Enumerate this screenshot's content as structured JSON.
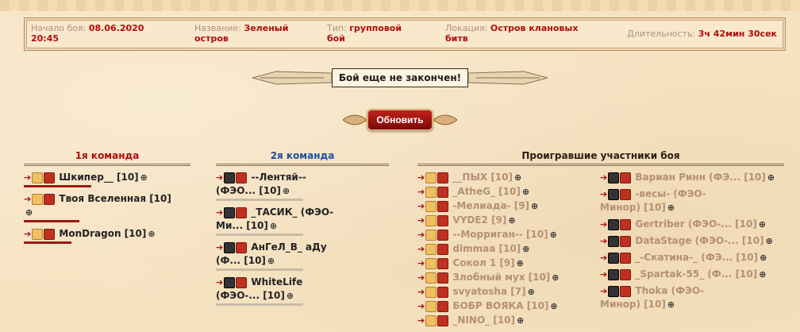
{
  "info": {
    "start_label": "Начало боя:",
    "start_value_line1": "08.06.2020",
    "start_value_line2": "20:45",
    "name_label": "Название:",
    "name_value_line1": "Зеленый",
    "name_value_line2": "остров",
    "type_label": "Тип:",
    "type_value_line1": "групповой",
    "type_value_line2": "бой",
    "location_label": "Локация:",
    "location_value_line1": "Остров клановых",
    "location_value_line2": "битв",
    "duration_label": "Длительность:",
    "duration_value": "3ч 42мин 30сек"
  },
  "status": "Бой еще не закончен!",
  "refresh_label": "Обновить",
  "team1": {
    "title": "1я команда",
    "players": [
      {
        "name": "Шкипер__ [10]"
      },
      {
        "name": "Твоя Вселенная [10]"
      },
      {
        "name": "MonDragon [10]"
      }
    ]
  },
  "team2": {
    "title": "2я команда",
    "players": [
      {
        "line1": "--Лентяй--",
        "line2": "(ФЭО... [10]"
      },
      {
        "line1": "_ТАСИК_ (ФЭО-",
        "line2": "Ми... [10]"
      },
      {
        "line1": "АнГеЛ_В_ аДу",
        "line2": "(Ф... [10]"
      },
      {
        "line1": "WhiteLife",
        "line2": "(ФЭО-... [10]"
      }
    ]
  },
  "lost": {
    "title": "Проигравшие участники боя",
    "col1": [
      "__ПЫХ [10]",
      "_AtheG_ [10]",
      "-Мелиада- [9]",
      "VYDE2 [9]",
      "--Морриган-- [10]",
      "dimmaa [10]",
      "Сокол 1 [9]",
      "Злобный мух [10]",
      "svyatosha [7]",
      "БОБР ВОЯКА [10]",
      "_NINO_ [10]"
    ],
    "col2": [
      {
        "line1": "Вариан Ринн (ФЭ... [10]",
        "line2": ""
      },
      {
        "line1": "-весы- (ФЭО-",
        "line2": "Минор) [10]"
      },
      {
        "line1": "Gertriber (ФЭО-... [10]",
        "line2": ""
      },
      {
        "line1": "DataStage (ФЭО-... [10]",
        "line2": ""
      },
      {
        "line1": "_-Скатина-_ (ФЭ... [10]",
        "line2": ""
      },
      {
        "line1": "_Spartak-55_ (Ф... [10]",
        "line2": ""
      },
      {
        "line1": "Thoka (ФЭО-",
        "line2": "Минор) [10]"
      }
    ]
  },
  "colors": {
    "accent": "#b00c0c",
    "team2": "#1c4fa0",
    "lost": "#b58f74"
  }
}
